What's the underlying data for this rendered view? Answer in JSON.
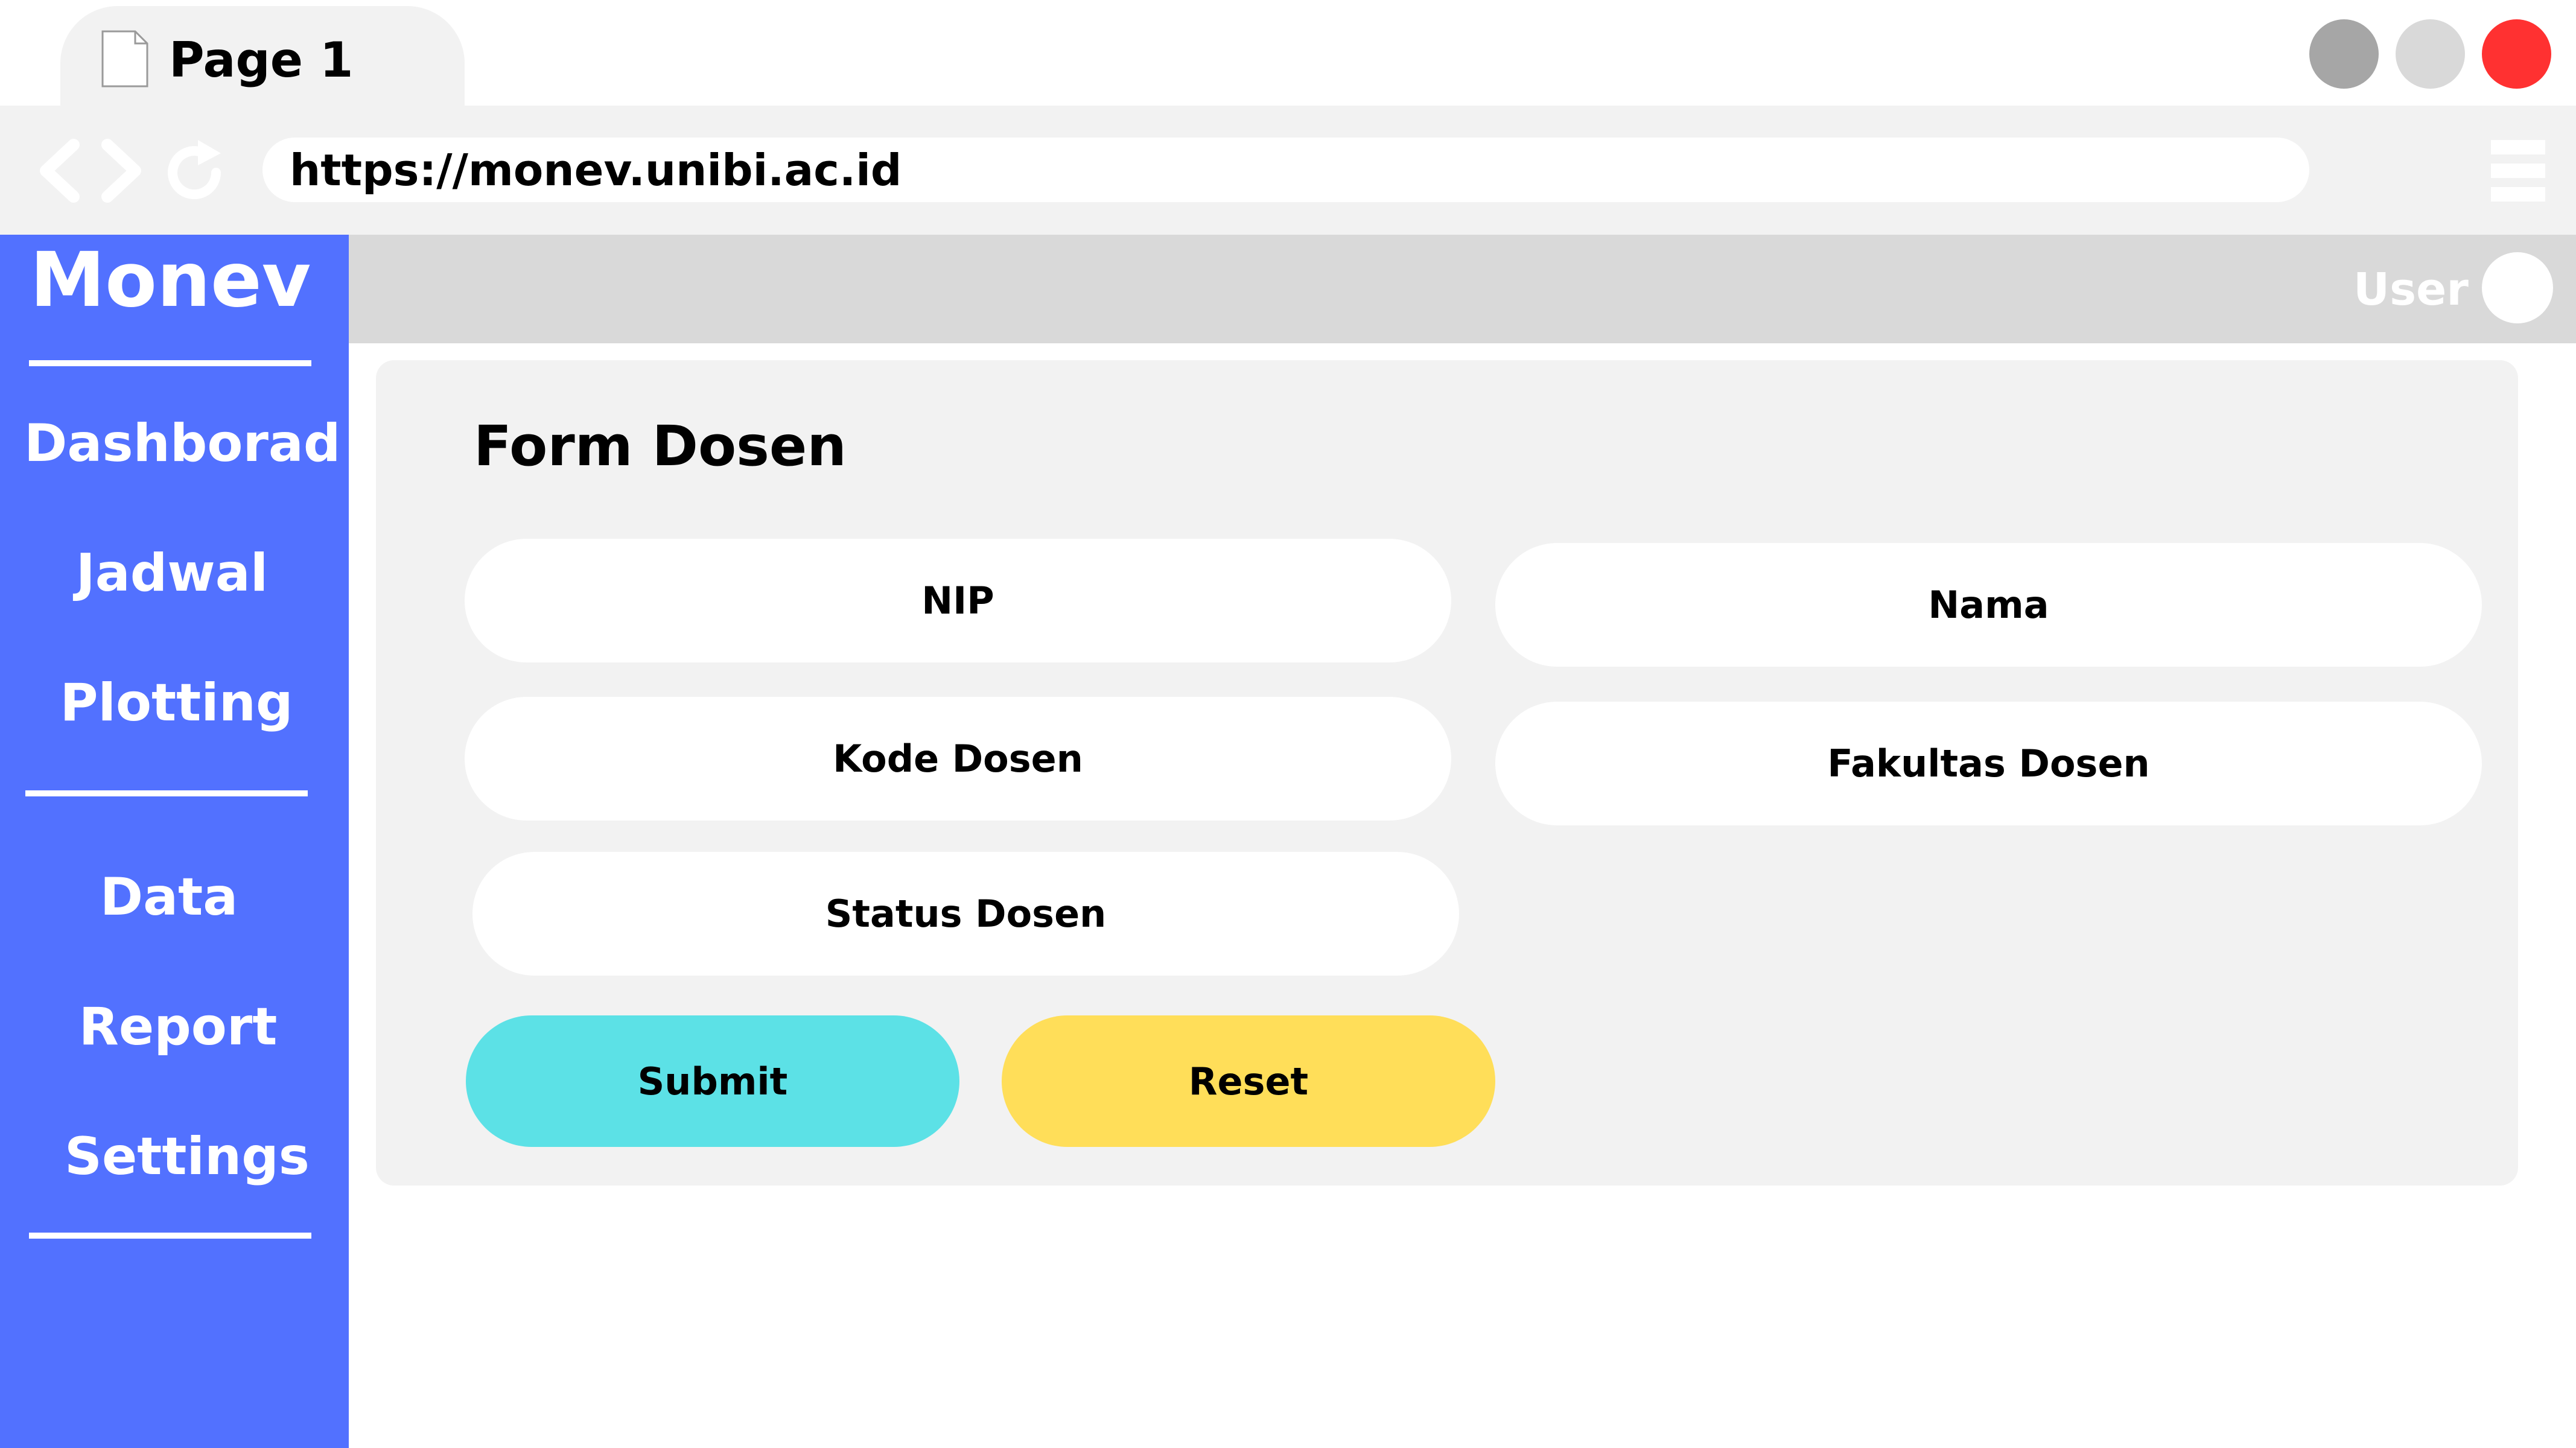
{
  "browser": {
    "tab_title": "Page 1",
    "url": "https://monev.unibi.ac.id",
    "icons": {
      "tab": "document-icon",
      "back": "chevron-left-icon",
      "forward": "chevron-right-icon",
      "reload": "reload-icon",
      "menu": "hamburger-menu-icon"
    },
    "window_button_colors": {
      "minimize": "#a6a6a6",
      "maximize": "#d9d9d9",
      "close": "#ff3131"
    }
  },
  "sidebar": {
    "brand": "Monev",
    "color": "#5271ff",
    "items": [
      {
        "label": "Dashborad"
      },
      {
        "label": "Jadwal"
      },
      {
        "label": "Plotting"
      },
      {
        "label": "Data"
      },
      {
        "label": "Report"
      },
      {
        "label": "Settings"
      }
    ]
  },
  "header": {
    "user_label": "User",
    "avatar_icon": "user-avatar-icon"
  },
  "form": {
    "title": "Form Dosen",
    "fields": {
      "nip": "NIP",
      "nama": "Nama",
      "kode_dosen": "Kode Dosen",
      "fakultas_dosen": "Fakultas Dosen",
      "status_dosen": "Status Dosen"
    },
    "buttons": {
      "submit": "Submit",
      "reset": "Reset"
    },
    "button_colors": {
      "submit": "#5ce1e6",
      "reset": "#ffde59"
    }
  }
}
